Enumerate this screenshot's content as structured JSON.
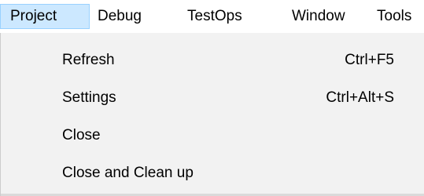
{
  "menubar": {
    "items": [
      {
        "label": "Project",
        "active": true
      },
      {
        "label": "Debug"
      },
      {
        "label": "TestOps"
      },
      {
        "label": "Window"
      },
      {
        "label": "Tools"
      }
    ]
  },
  "dropdown": {
    "items": [
      {
        "label": "Refresh",
        "shortcut": "Ctrl+F5"
      },
      {
        "label": "Settings",
        "shortcut": "Ctrl+Alt+S"
      },
      {
        "label": "Close",
        "shortcut": ""
      },
      {
        "label": "Close and Clean up",
        "shortcut": ""
      }
    ]
  },
  "colors": {
    "active_menu_bg": "#cce8ff",
    "active_menu_border": "#99d1ff",
    "dropdown_bg": "#f2f2f2"
  }
}
